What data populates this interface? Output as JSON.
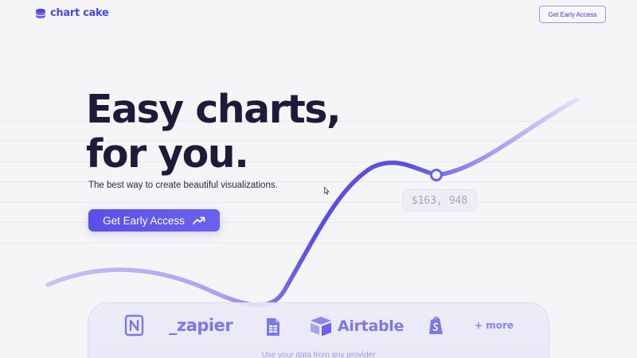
{
  "header": {
    "logo_text": "chart cake",
    "cta_label": "Get Early Access"
  },
  "hero": {
    "title_line1": "Easy charts,",
    "title_line2": "for you.",
    "subtitle": "The best way to create beautiful visualizations.",
    "cta_label": "Get Early Access",
    "cta_icon": "trending-up-icon"
  },
  "chart_badge": {
    "value": "$163, 948"
  },
  "integrations": {
    "items": [
      {
        "name": "notion",
        "icon": "notion-icon"
      },
      {
        "name": "zapier",
        "label": "_zapier"
      },
      {
        "name": "google-sheets",
        "icon": "sheets-icon"
      },
      {
        "name": "airtable",
        "label": "Airtable",
        "icon": "airtable-icon"
      },
      {
        "name": "shopify",
        "icon": "shopify-icon"
      },
      {
        "name": "more",
        "label": "+ more"
      }
    ],
    "caption": "Use your data from any provider"
  },
  "colors": {
    "brand": "#4f46d8",
    "accent": "#6b61f0",
    "title": "#1d1b3a",
    "integration": "#7e77e6"
  }
}
